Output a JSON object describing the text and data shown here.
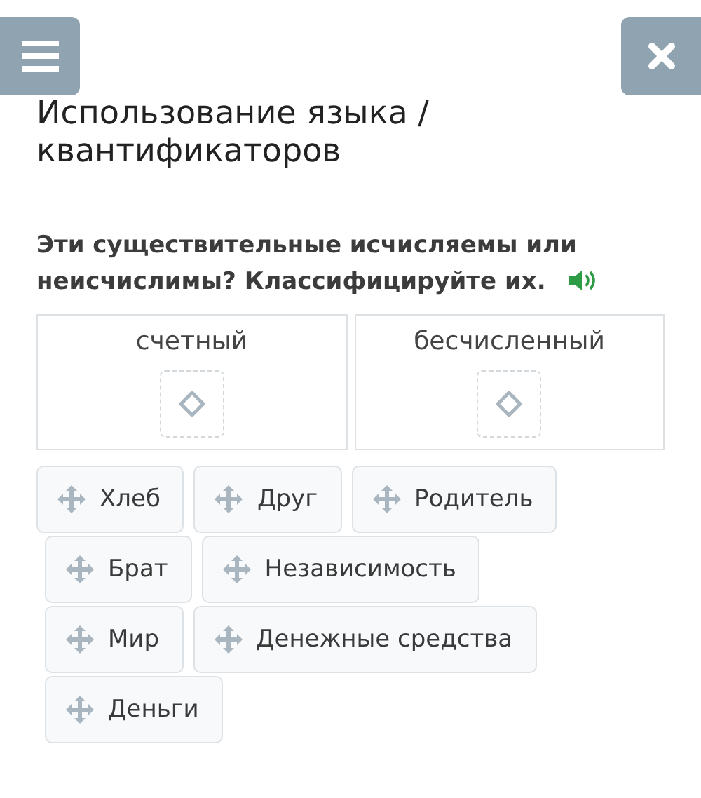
{
  "title": "Использование языка / квантификаторов",
  "question": "Эти существительные исчисляемы или неисчислимы? Классифицируйте их.",
  "categories": [
    {
      "label": "счетный"
    },
    {
      "label": "бесчисленный"
    }
  ],
  "words": [
    "Хлеб",
    "Друг",
    "Родитель",
    "Брат",
    "Независимость",
    "Мир",
    "Денежные средства",
    "Деньги"
  ]
}
